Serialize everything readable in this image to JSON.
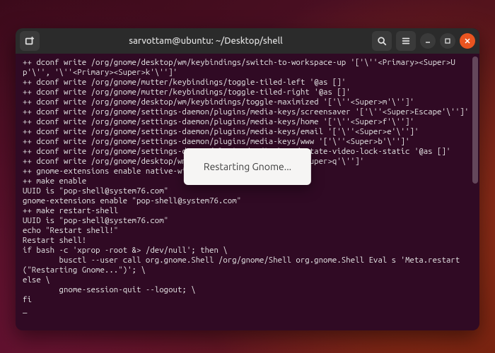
{
  "window": {
    "title": "sarvottam@ubuntu: ~/Desktop/shell"
  },
  "icons": {
    "new_tab": "new-tab-icon",
    "search": "search-icon",
    "menu": "hamburger-icon",
    "minimize": "minimize-icon",
    "maximize": "maximize-icon",
    "close": "close-icon"
  },
  "toast": {
    "message": "Restarting Gnome..."
  },
  "terminal": {
    "output": "++ dconf write /org/gnome/desktop/wm/keybindings/switch-to-workspace-up '['\\''<Primary><Super>Up'\\'', '\\''<Primary><Super>k'\\'']'\n++ dconf write /org/gnome/mutter/keybindings/toggle-tiled-left '@as []'\n++ dconf write /org/gnome/mutter/keybindings/toggle-tiled-right '@as []'\n++ dconf write /org/gnome/desktop/wm/keybindings/toggle-maximized '['\\''<Super>m'\\'']'\n++ dconf write /org/gnome/settings-daemon/plugins/media-keys/screensaver '['\\''<Super>Escape'\\'']'\n++ dconf write /org/gnome/settings-daemon/plugins/media-keys/home '['\\''<Super>f'\\'']'\n++ dconf write /org/gnome/settings-daemon/plugins/media-keys/email '['\\''<Super>e'\\'']'\n++ dconf write /org/gnome/settings-daemon/plugins/media-keys/www '['\\''<Super>b'\\'']'\n++ dconf write /org/gnome/settings-daemon/plugins/media-keys/rotate-video-lock-static '@as []'\n++ dconf write /org/gnome/desktop/wm/keybindings/close '['\\''<Super>q'\\'']'\n++ gnome-extensions enable native-window-placement\n++ make enable\nUUID is \"pop-shell@system76.com\"\ngnome-extensions enable \"pop-shell@system76.com\"\n++ make restart-shell\nUUID is \"pop-shell@system76.com\"\necho \"Restart shell!\"\nRestart shell!\nif bash -c 'xprop -root &> /dev/null'; then \\\n        busctl --user call org.gnome.Shell /org/gnome/Shell org.gnome.Shell Eval s 'Meta.restart(\"Restarting Gnome...\")'; \\\nelse \\\n        gnome-session-quit --logout; \\\nfi\n_"
  }
}
